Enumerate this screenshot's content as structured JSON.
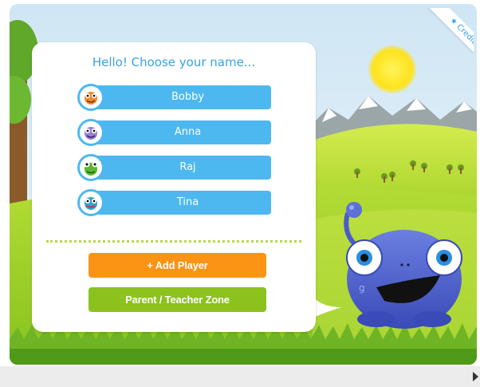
{
  "panel": {
    "title": "Hello! Choose your name..."
  },
  "players": [
    {
      "name": "Bobby",
      "avatar": "orange-monster-icon",
      "color": "#f28a2c"
    },
    {
      "name": "Anna",
      "avatar": "purple-monster-icon",
      "color": "#9b7fd6"
    },
    {
      "name": "Raj",
      "avatar": "green-frog-icon",
      "color": "#5cb82e"
    },
    {
      "name": "Tina",
      "avatar": "blue-monster-icon",
      "color": "#3aa0c8"
    }
  ],
  "buttons": {
    "add_player": "+ Add Player",
    "parent_zone": "Parent / Teacher Zone"
  },
  "corner": {
    "credits": "★ Credits"
  },
  "mascot": {
    "letter": "g"
  },
  "colors": {
    "accent_blue": "#4db8f0",
    "orange": "#fb9414",
    "green": "#8cc21e",
    "title_blue": "#3aa3de"
  }
}
